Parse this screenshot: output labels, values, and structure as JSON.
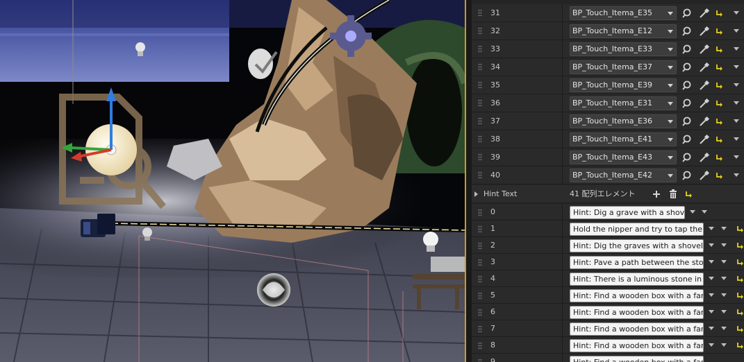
{
  "touch_items": [
    {
      "index": "31",
      "value": "BP_Touch_Itema_E35"
    },
    {
      "index": "32",
      "value": "BP_Touch_Itema_E12"
    },
    {
      "index": "33",
      "value": "BP_Touch_Itema_E33"
    },
    {
      "index": "34",
      "value": "BP_Touch_Itema_E37"
    },
    {
      "index": "35",
      "value": "BP_Touch_Itema_E39"
    },
    {
      "index": "36",
      "value": "BP_Touch_Itema_E31"
    },
    {
      "index": "37",
      "value": "BP_Touch_Itema_E36"
    },
    {
      "index": "38",
      "value": "BP_Touch_Itema_E41"
    },
    {
      "index": "39",
      "value": "BP_Touch_Itema_E43"
    },
    {
      "index": "40",
      "value": "BP_Touch_Itema_E42"
    }
  ],
  "hint_text": {
    "label": "Hint Text",
    "count_label": "41 配列エレメント",
    "items": [
      {
        "index": "0",
        "value": "Hint: Dig a grave with a shovel."
      },
      {
        "index": "1",
        "value": "Hold the nipper and try to tap the sho"
      },
      {
        "index": "2",
        "value": "Hint: Dig the graves with a shovel un"
      },
      {
        "index": "3",
        "value": "Hint: Pave a path between the stones"
      },
      {
        "index": "4",
        "value": "Hint: There is a luminous stone in the"
      },
      {
        "index": "5",
        "value": "Hint: Find a wooden box with a famili"
      },
      {
        "index": "6",
        "value": "Hint: Find a wooden box with a famili"
      },
      {
        "index": "7",
        "value": "Hint: Find a wooden box with a famili"
      },
      {
        "index": "8",
        "value": "Hint: Find a wooden box with a famili"
      },
      {
        "index": "9",
        "value": "Hint: Find a wooden box with a famili"
      }
    ]
  },
  "icons": {
    "browse": "magnifier-icon",
    "pick": "eyedropper-icon",
    "reset": "reset-arrow-icon",
    "add": "plus-icon",
    "delete": "trash-icon"
  },
  "colors": {
    "accent_reset": "#e8d41a",
    "viewport_border": "#d49a1e",
    "panel_bg": "#242424"
  }
}
